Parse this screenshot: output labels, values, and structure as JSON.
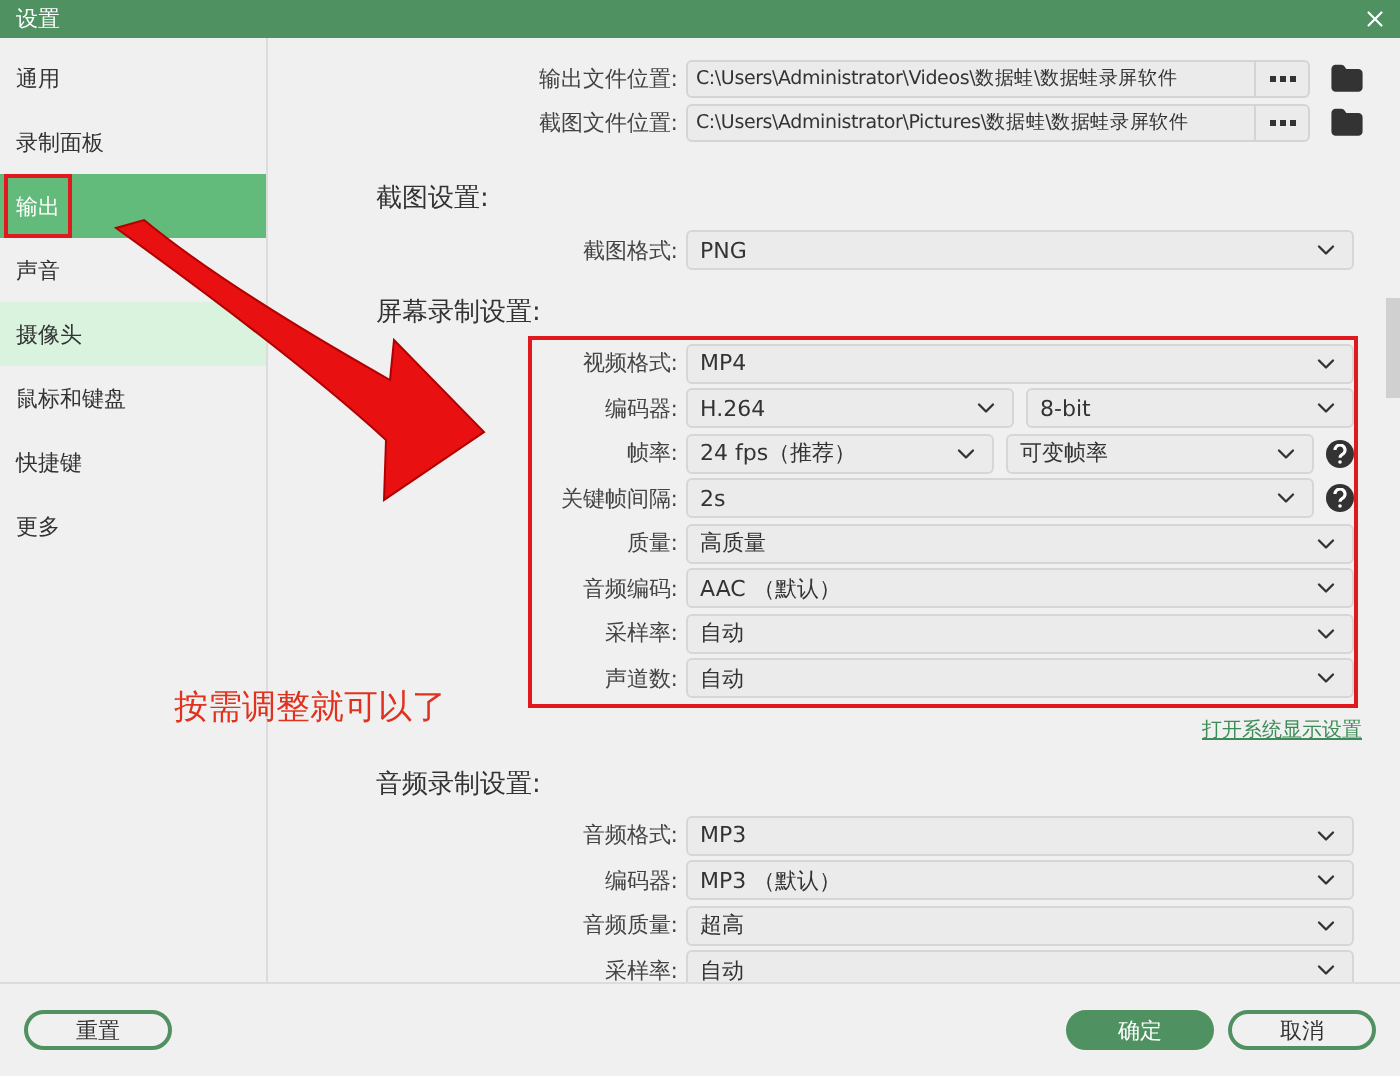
{
  "window": {
    "title": "设置"
  },
  "sidebar": {
    "items": [
      {
        "label": "通用",
        "selected": false,
        "hovered": false,
        "marked": false
      },
      {
        "label": "录制面板",
        "selected": false,
        "hovered": false,
        "marked": false
      },
      {
        "label": "输出",
        "selected": true,
        "hovered": false,
        "marked": true
      },
      {
        "label": "声音",
        "selected": false,
        "hovered": false,
        "marked": false
      },
      {
        "label": "摄像头",
        "selected": false,
        "hovered": true,
        "marked": false
      },
      {
        "label": "鼠标和键盘",
        "selected": false,
        "hovered": false,
        "marked": false
      },
      {
        "label": "快捷键",
        "selected": false,
        "hovered": false,
        "marked": false
      },
      {
        "label": "更多",
        "selected": false,
        "hovered": false,
        "marked": false
      }
    ]
  },
  "paths": [
    {
      "label": "输出文件位置:",
      "value": "C:\\Users\\Administrator\\Videos\\数据蛙\\数据蛙录屏软件"
    },
    {
      "label": "截图文件位置:",
      "value": "C:\\Users\\Administrator\\Pictures\\数据蛙\\数据蛙录屏软件"
    }
  ],
  "sections": [
    {
      "title": "截图设置:",
      "highlighted": false,
      "rows": [
        {
          "label": "截图格式:",
          "fields": [
            "PNG"
          ],
          "help": false
        }
      ]
    },
    {
      "title": "屏幕录制设置:",
      "highlighted": true,
      "link": "打开系统显示设置",
      "rows": [
        {
          "label": "视频格式:",
          "fields": [
            "MP4"
          ],
          "help": false
        },
        {
          "label": "编码器:",
          "fields": [
            "H.264",
            "8-bit"
          ],
          "help": false
        },
        {
          "label": "帧率:",
          "fields": [
            "24 fps（推荐）",
            "可变帧率"
          ],
          "help": true
        },
        {
          "label": "关键帧间隔:",
          "fields": [
            "2s"
          ],
          "help": true
        },
        {
          "label": "质量:",
          "fields": [
            "高质量"
          ],
          "help": false
        },
        {
          "label": "音频编码:",
          "fields": [
            "AAC （默认）"
          ],
          "help": false
        },
        {
          "label": "采样率:",
          "fields": [
            "自动"
          ],
          "help": false
        },
        {
          "label": "声道数:",
          "fields": [
            "自动"
          ],
          "help": false
        }
      ]
    },
    {
      "title": "音频录制设置:",
      "highlighted": false,
      "rows": [
        {
          "label": "音频格式:",
          "fields": [
            "MP3"
          ],
          "help": false
        },
        {
          "label": "编码器:",
          "fields": [
            "MP3 （默认）"
          ],
          "help": false
        },
        {
          "label": "音频质量:",
          "fields": [
            "超高"
          ],
          "help": false
        },
        {
          "label": "采样率:",
          "fields": [
            "自动"
          ],
          "help": false
        }
      ]
    }
  ],
  "annotation": {
    "text": "按需调整就可以了"
  },
  "footer": {
    "left": [
      {
        "label": "重置",
        "kind": "outline"
      }
    ],
    "right": [
      {
        "label": "确定",
        "kind": "primary"
      },
      {
        "label": "取消",
        "kind": "outline"
      }
    ]
  }
}
